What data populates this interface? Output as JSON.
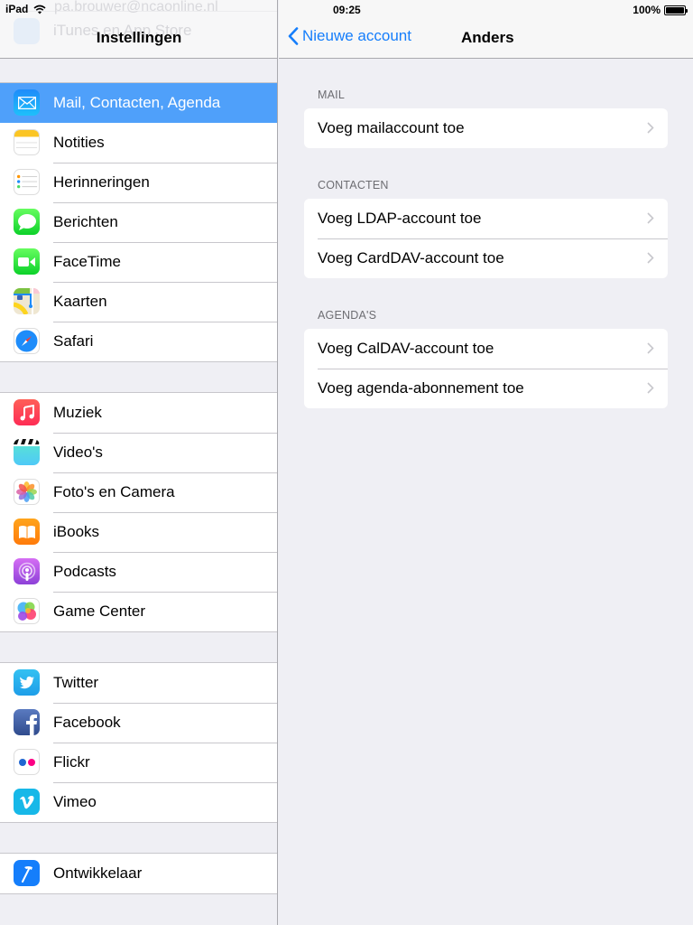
{
  "status_bar": {
    "device": "iPad",
    "time": "09:25",
    "battery_percent_label": "100%",
    "battery_level": 1.0
  },
  "left_pane": {
    "title": "Instellingen",
    "ghost_email": "pa.brouwer@ncaonline.nl",
    "ghost_item": "iTunes en App Store",
    "groups": [
      {
        "items": [
          {
            "label": "Mail, Contacten, Agenda",
            "icon": "mail-icon",
            "selected": true
          },
          {
            "label": "Notities",
            "icon": "notes-icon"
          },
          {
            "label": "Herinneringen",
            "icon": "reminders-icon"
          },
          {
            "label": "Berichten",
            "icon": "messages-icon"
          },
          {
            "label": "FaceTime",
            "icon": "facetime-icon"
          },
          {
            "label": "Kaarten",
            "icon": "maps-icon"
          },
          {
            "label": "Safari",
            "icon": "safari-icon"
          }
        ]
      },
      {
        "items": [
          {
            "label": "Muziek",
            "icon": "music-icon"
          },
          {
            "label": "Video's",
            "icon": "videos-icon"
          },
          {
            "label": "Foto's en Camera",
            "icon": "photos-icon"
          },
          {
            "label": "iBooks",
            "icon": "ibooks-icon"
          },
          {
            "label": "Podcasts",
            "icon": "podcasts-icon"
          },
          {
            "label": "Game Center",
            "icon": "game-center-icon"
          }
        ]
      },
      {
        "items": [
          {
            "label": "Twitter",
            "icon": "twitter-icon"
          },
          {
            "label": "Facebook",
            "icon": "facebook-icon"
          },
          {
            "label": "Flickr",
            "icon": "flickr-icon"
          },
          {
            "label": "Vimeo",
            "icon": "vimeo-icon"
          }
        ]
      },
      {
        "items": [
          {
            "label": "Ontwikkelaar",
            "icon": "developer-icon"
          }
        ]
      }
    ]
  },
  "right_pane": {
    "back_label": "Nieuwe account",
    "title": "Anders",
    "sections": [
      {
        "header": "MAIL",
        "items": [
          "Voeg mailaccount toe"
        ]
      },
      {
        "header": "CONTACTEN",
        "items": [
          "Voeg LDAP-account toe",
          "Voeg CardDAV-account toe"
        ]
      },
      {
        "header": "AGENDA'S",
        "items": [
          "Voeg CalDAV-account toe",
          "Voeg agenda-abonnement toe"
        ]
      }
    ]
  },
  "colors": {
    "accent": "#157efb",
    "selected_row": "#4fa0fa",
    "background": "#efeff4",
    "separator": "#c8c7cc",
    "section_header": "#6d6d72"
  }
}
